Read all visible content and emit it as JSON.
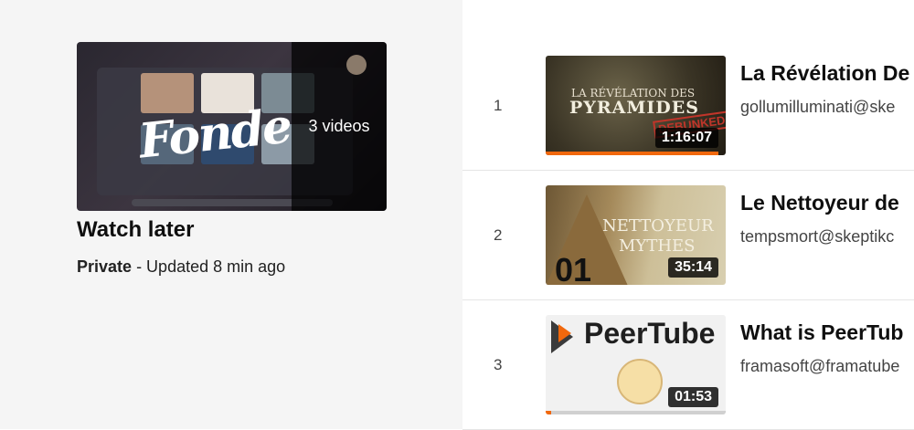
{
  "playlist": {
    "video_count": "3 videos",
    "title": "Watch later",
    "privacy": "Private",
    "updated": "- Updated 8 min ago",
    "thumb_text": "Fonde"
  },
  "videos": [
    {
      "position": "1",
      "title": "La Révélation De",
      "channel": "gollumilluminati@ske",
      "duration": "1:16:07",
      "thumb_caption_small": "LA RÉVÉLATION DES",
      "thumb_caption_big": "PYRAMIDES",
      "thumb_stamp": "DEBUNKED",
      "watched_fraction": 0.96
    },
    {
      "position": "2",
      "title": "Le Nettoyeur de",
      "channel": "tempsmort@skeptikc",
      "duration": "35:14",
      "thumb_caption_small": "NETTOYEUR",
      "thumb_caption_big": "MYTHES",
      "thumb_stamp": "01",
      "watched_fraction": 0
    },
    {
      "position": "3",
      "title": "What is PeerTub",
      "channel": "framasoft@framatube",
      "duration": "01:53",
      "thumb_caption_big": "PeerTube",
      "watched_fraction": 0.03
    }
  ],
  "colors": {
    "progress": "#f1680d",
    "progress_track": "#d0d0d0"
  },
  "icons": {
    "peertube_logo": "peertube-logo-icon"
  }
}
